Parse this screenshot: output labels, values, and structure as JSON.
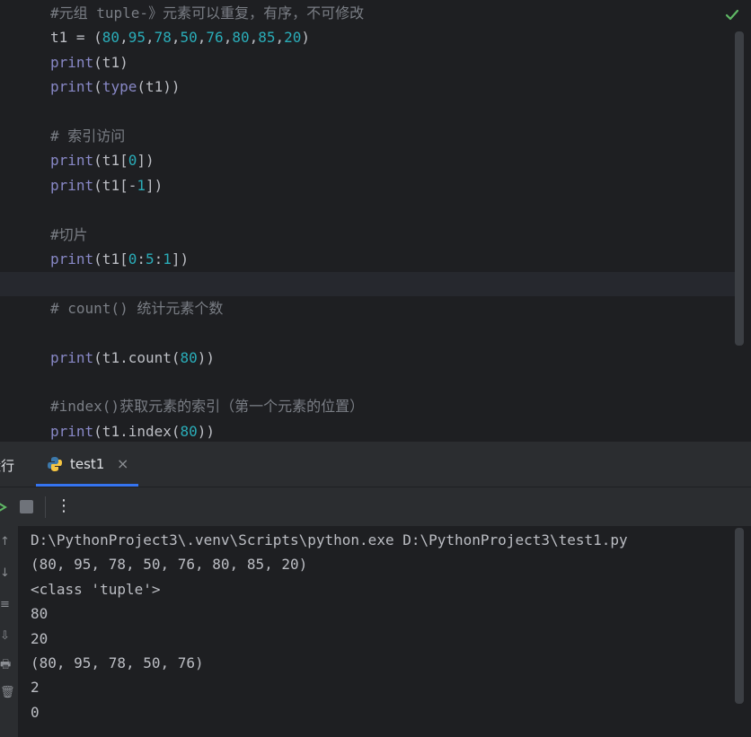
{
  "editor": {
    "lines": [
      {
        "row": 0,
        "segments": [
          {
            "t": "#元组 tuple-》元素可以重复，有序，不可修改",
            "c": "comment"
          }
        ]
      },
      {
        "row": 1,
        "segments": [
          {
            "t": "t1 = (",
            "c": "plain"
          },
          {
            "t": "80",
            "c": "num"
          },
          {
            "t": ",",
            "c": "plain"
          },
          {
            "t": "95",
            "c": "num"
          },
          {
            "t": ",",
            "c": "plain"
          },
          {
            "t": "78",
            "c": "num"
          },
          {
            "t": ",",
            "c": "plain"
          },
          {
            "t": "50",
            "c": "num"
          },
          {
            "t": ",",
            "c": "plain"
          },
          {
            "t": "76",
            "c": "num"
          },
          {
            "t": ",",
            "c": "plain"
          },
          {
            "t": "80",
            "c": "num"
          },
          {
            "t": ",",
            "c": "plain"
          },
          {
            "t": "85",
            "c": "num"
          },
          {
            "t": ",",
            "c": "plain"
          },
          {
            "t": "20",
            "c": "num"
          },
          {
            "t": ")",
            "c": "plain"
          }
        ]
      },
      {
        "row": 2,
        "segments": [
          {
            "t": "print",
            "c": "builtin"
          },
          {
            "t": "(t1)",
            "c": "plain"
          }
        ]
      },
      {
        "row": 3,
        "segments": [
          {
            "t": "print",
            "c": "builtin"
          },
          {
            "t": "(",
            "c": "plain"
          },
          {
            "t": "type",
            "c": "builtin"
          },
          {
            "t": "(t1))",
            "c": "plain"
          }
        ]
      },
      {
        "row": 5,
        "segments": [
          {
            "t": "# 索引访问",
            "c": "comment"
          }
        ]
      },
      {
        "row": 6,
        "segments": [
          {
            "t": "print",
            "c": "builtin"
          },
          {
            "t": "(t1[",
            "c": "plain"
          },
          {
            "t": "0",
            "c": "num"
          },
          {
            "t": "])",
            "c": "plain"
          }
        ]
      },
      {
        "row": 7,
        "segments": [
          {
            "t": "print",
            "c": "builtin"
          },
          {
            "t": "(t1[-",
            "c": "plain"
          },
          {
            "t": "1",
            "c": "num"
          },
          {
            "t": "])",
            "c": "plain"
          }
        ]
      },
      {
        "row": 9,
        "segments": [
          {
            "t": "#切片",
            "c": "comment"
          }
        ]
      },
      {
        "row": 10,
        "segments": [
          {
            "t": "print",
            "c": "builtin"
          },
          {
            "t": "(t1[",
            "c": "plain"
          },
          {
            "t": "0",
            "c": "num"
          },
          {
            "t": ":",
            "c": "plain"
          },
          {
            "t": "5",
            "c": "num"
          },
          {
            "t": ":",
            "c": "plain"
          },
          {
            "t": "1",
            "c": "num"
          },
          {
            "t": "])",
            "c": "plain"
          }
        ]
      },
      {
        "row": 12,
        "segments": [
          {
            "t": "# count() 统计元素个数",
            "c": "comment"
          }
        ]
      },
      {
        "row": 14,
        "segments": [
          {
            "t": "print",
            "c": "builtin"
          },
          {
            "t": "(t1.count(",
            "c": "plain"
          },
          {
            "t": "80",
            "c": "num"
          },
          {
            "t": "))",
            "c": "plain"
          }
        ]
      },
      {
        "row": 16,
        "segments": [
          {
            "t": "#index()获取元素的索引（第一个元素的位置）",
            "c": "comment"
          }
        ]
      },
      {
        "row": 17,
        "segments": [
          {
            "t": "print",
            "c": "builtin"
          },
          {
            "t": "(t1.index(",
            "c": "plain"
          },
          {
            "t": "80",
            "c": "num"
          },
          {
            "t": "))",
            "c": "plain"
          }
        ]
      }
    ]
  },
  "run_panel": {
    "title": "运行",
    "tab_label": "test1",
    "tab_close": "×",
    "more": "⋮"
  },
  "console": {
    "gutter_glyphs": [
      "↑",
      "↓",
      "≡",
      "⇩",
      "🖶",
      "🗑"
    ],
    "lines": [
      "D:\\PythonProject3\\.venv\\Scripts\\python.exe D:\\PythonProject3\\test1.py",
      "(80, 95, 78, 50, 76, 80, 85, 20)",
      "<class 'tuple'>",
      "80",
      "20",
      "(80, 95, 78, 50, 76)",
      "2",
      "0"
    ]
  },
  "colors": {
    "comment": "#7a7e85",
    "builtin": "#8888c6",
    "number": "#2aacb8",
    "text": "#bcbec4",
    "accent": "#3574f0",
    "check": "#5fb865"
  }
}
